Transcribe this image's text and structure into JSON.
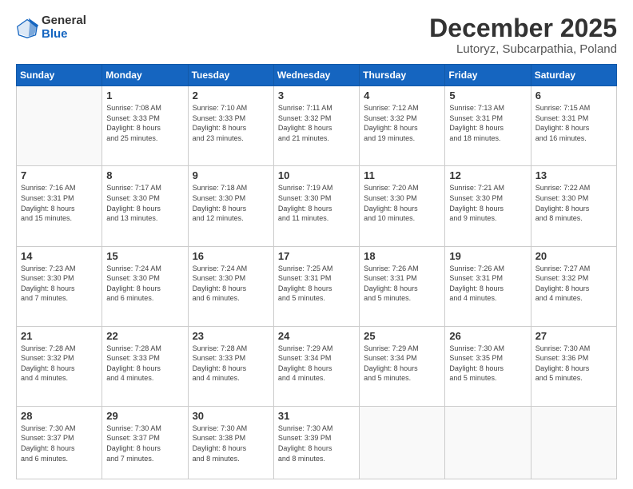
{
  "logo": {
    "general": "General",
    "blue": "Blue"
  },
  "header": {
    "month": "December 2025",
    "location": "Lutoryz, Subcarpathia, Poland"
  },
  "days_of_week": [
    "Sunday",
    "Monday",
    "Tuesday",
    "Wednesday",
    "Thursday",
    "Friday",
    "Saturday"
  ],
  "weeks": [
    [
      {
        "day": "",
        "info": ""
      },
      {
        "day": "1",
        "info": "Sunrise: 7:08 AM\nSunset: 3:33 PM\nDaylight: 8 hours\nand 25 minutes."
      },
      {
        "day": "2",
        "info": "Sunrise: 7:10 AM\nSunset: 3:33 PM\nDaylight: 8 hours\nand 23 minutes."
      },
      {
        "day": "3",
        "info": "Sunrise: 7:11 AM\nSunset: 3:32 PM\nDaylight: 8 hours\nand 21 minutes."
      },
      {
        "day": "4",
        "info": "Sunrise: 7:12 AM\nSunset: 3:32 PM\nDaylight: 8 hours\nand 19 minutes."
      },
      {
        "day": "5",
        "info": "Sunrise: 7:13 AM\nSunset: 3:31 PM\nDaylight: 8 hours\nand 18 minutes."
      },
      {
        "day": "6",
        "info": "Sunrise: 7:15 AM\nSunset: 3:31 PM\nDaylight: 8 hours\nand 16 minutes."
      }
    ],
    [
      {
        "day": "7",
        "info": "Sunrise: 7:16 AM\nSunset: 3:31 PM\nDaylight: 8 hours\nand 15 minutes."
      },
      {
        "day": "8",
        "info": "Sunrise: 7:17 AM\nSunset: 3:30 PM\nDaylight: 8 hours\nand 13 minutes."
      },
      {
        "day": "9",
        "info": "Sunrise: 7:18 AM\nSunset: 3:30 PM\nDaylight: 8 hours\nand 12 minutes."
      },
      {
        "day": "10",
        "info": "Sunrise: 7:19 AM\nSunset: 3:30 PM\nDaylight: 8 hours\nand 11 minutes."
      },
      {
        "day": "11",
        "info": "Sunrise: 7:20 AM\nSunset: 3:30 PM\nDaylight: 8 hours\nand 10 minutes."
      },
      {
        "day": "12",
        "info": "Sunrise: 7:21 AM\nSunset: 3:30 PM\nDaylight: 8 hours\nand 9 minutes."
      },
      {
        "day": "13",
        "info": "Sunrise: 7:22 AM\nSunset: 3:30 PM\nDaylight: 8 hours\nand 8 minutes."
      }
    ],
    [
      {
        "day": "14",
        "info": "Sunrise: 7:23 AM\nSunset: 3:30 PM\nDaylight: 8 hours\nand 7 minutes."
      },
      {
        "day": "15",
        "info": "Sunrise: 7:24 AM\nSunset: 3:30 PM\nDaylight: 8 hours\nand 6 minutes."
      },
      {
        "day": "16",
        "info": "Sunrise: 7:24 AM\nSunset: 3:30 PM\nDaylight: 8 hours\nand 6 minutes."
      },
      {
        "day": "17",
        "info": "Sunrise: 7:25 AM\nSunset: 3:31 PM\nDaylight: 8 hours\nand 5 minutes."
      },
      {
        "day": "18",
        "info": "Sunrise: 7:26 AM\nSunset: 3:31 PM\nDaylight: 8 hours\nand 5 minutes."
      },
      {
        "day": "19",
        "info": "Sunrise: 7:26 AM\nSunset: 3:31 PM\nDaylight: 8 hours\nand 4 minutes."
      },
      {
        "day": "20",
        "info": "Sunrise: 7:27 AM\nSunset: 3:32 PM\nDaylight: 8 hours\nand 4 minutes."
      }
    ],
    [
      {
        "day": "21",
        "info": "Sunrise: 7:28 AM\nSunset: 3:32 PM\nDaylight: 8 hours\nand 4 minutes."
      },
      {
        "day": "22",
        "info": "Sunrise: 7:28 AM\nSunset: 3:33 PM\nDaylight: 8 hours\nand 4 minutes."
      },
      {
        "day": "23",
        "info": "Sunrise: 7:28 AM\nSunset: 3:33 PM\nDaylight: 8 hours\nand 4 minutes."
      },
      {
        "day": "24",
        "info": "Sunrise: 7:29 AM\nSunset: 3:34 PM\nDaylight: 8 hours\nand 4 minutes."
      },
      {
        "day": "25",
        "info": "Sunrise: 7:29 AM\nSunset: 3:34 PM\nDaylight: 8 hours\nand 5 minutes."
      },
      {
        "day": "26",
        "info": "Sunrise: 7:30 AM\nSunset: 3:35 PM\nDaylight: 8 hours\nand 5 minutes."
      },
      {
        "day": "27",
        "info": "Sunrise: 7:30 AM\nSunset: 3:36 PM\nDaylight: 8 hours\nand 5 minutes."
      }
    ],
    [
      {
        "day": "28",
        "info": "Sunrise: 7:30 AM\nSunset: 3:37 PM\nDaylight: 8 hours\nand 6 minutes."
      },
      {
        "day": "29",
        "info": "Sunrise: 7:30 AM\nSunset: 3:37 PM\nDaylight: 8 hours\nand 7 minutes."
      },
      {
        "day": "30",
        "info": "Sunrise: 7:30 AM\nSunset: 3:38 PM\nDaylight: 8 hours\nand 8 minutes."
      },
      {
        "day": "31",
        "info": "Sunrise: 7:30 AM\nSunset: 3:39 PM\nDaylight: 8 hours\nand 8 minutes."
      },
      {
        "day": "",
        "info": ""
      },
      {
        "day": "",
        "info": ""
      },
      {
        "day": "",
        "info": ""
      }
    ]
  ]
}
